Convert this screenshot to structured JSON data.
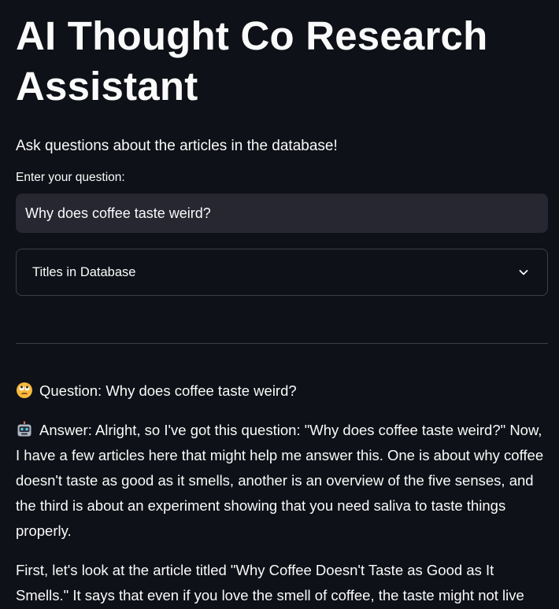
{
  "app": {
    "title": "AI Thought Co Research Assistant",
    "subtitle": "Ask questions about the articles in the database!"
  },
  "question_input": {
    "label": "Enter your question:",
    "value": "Why does coffee taste weird?"
  },
  "expander": {
    "label": "Titles in Database",
    "icon": "chevron-down-icon"
  },
  "qa": {
    "question_icon": "face-with-rolling-eyes-icon",
    "question_text": "Question: Why does coffee taste weird?",
    "answer_icon": "robot-icon",
    "answer_paragraphs": [
      "Answer: Alright, so I've got this question: \"Why does coffee taste weird?\" Now, I have a few articles here that might help me answer this. One is about why coffee doesn't taste as good as it smells, another is an overview of the five senses, and the third is about an experiment showing that you need saliva to taste things properly.",
      "First, let's look at the article titled \"Why Coffee Doesn't Taste as Good as It Smells.\" It says that even if you love the smell of coffee, the taste might not live"
    ]
  },
  "colors": {
    "background": "#0e1117",
    "text": "#fafafa",
    "input_background": "#262730"
  }
}
